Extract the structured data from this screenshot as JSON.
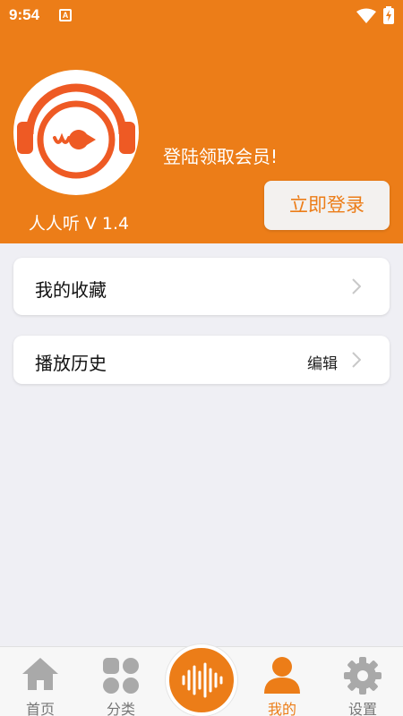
{
  "status_bar": {
    "time": "9:54",
    "notification_icon": "a-badge-icon",
    "wifi_icon": "wifi-icon",
    "battery_icon": "battery-charging-icon"
  },
  "header": {
    "logo_icon": "headphones-logo-icon",
    "app_version": "人人听 V 1.4",
    "promo_text": "登陆领取会员!",
    "login_button": "立即登录"
  },
  "menu": {
    "favorites": {
      "label": "我的收藏",
      "icon": "chevron-right-icon"
    },
    "history": {
      "label": "播放历史",
      "action": "编辑",
      "icon": "chevron-right-icon"
    }
  },
  "bottom_nav": {
    "items": [
      {
        "label": "首页",
        "icon": "home-icon"
      },
      {
        "label": "分类",
        "icon": "category-grid-icon"
      },
      {
        "label": "",
        "icon": "audio-wave-icon"
      },
      {
        "label": "我的",
        "icon": "person-icon",
        "active": true
      },
      {
        "label": "设置",
        "icon": "gear-icon"
      }
    ]
  },
  "colors": {
    "accent": "#ec7d18",
    "background": "#efeff4",
    "card": "#ffffff",
    "nav_inactive": "#777777"
  }
}
